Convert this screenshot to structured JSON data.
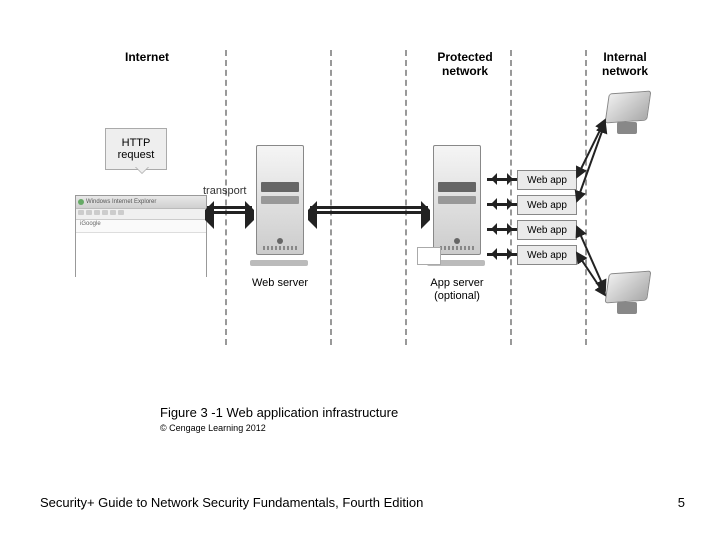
{
  "zones": {
    "internet": "Internet",
    "protected": "Protected\nnetwork",
    "internal": "Internal\nnetwork"
  },
  "callout": "HTTP\nrequest",
  "browser": {
    "title": "Windows Internet Explorer",
    "tab": "iGoogle"
  },
  "labels": {
    "transport": "transport",
    "web_server": "Web server",
    "app_server": "App server\n(optional)",
    "web_app": "Web app"
  },
  "caption": "Figure 3 -1 Web application infrastructure",
  "copyright": "© Cengage Learning 2012",
  "footer": "Security+ Guide to Network Security Fundamentals, Fourth Edition",
  "page": "5"
}
